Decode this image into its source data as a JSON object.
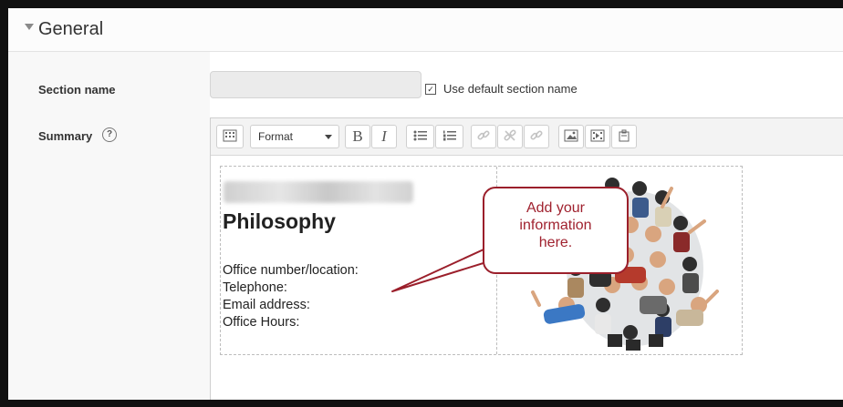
{
  "section": {
    "title": "General"
  },
  "form": {
    "section_name_label": "Section name",
    "section_name_value": "",
    "use_default_label": "Use default section name",
    "use_default_checked": true,
    "summary_label": "Summary",
    "help_glyph": "?"
  },
  "toolbar": {
    "format_label": "Format",
    "bold": "B",
    "italic": "I",
    "icons": [
      "toolbar-toggle-icon",
      "bold-icon",
      "italic-icon",
      "unordered-list-icon",
      "ordered-list-icon",
      "link-icon",
      "unlink-icon",
      "no-link-icon",
      "image-icon",
      "media-icon",
      "manage-files-icon"
    ]
  },
  "content": {
    "name_blurred": "Lorem, Dr. Donnie",
    "heading": "Philosophy",
    "lines": [
      "Office number/location:",
      "Telephone:",
      "Email address:",
      "Office Hours:"
    ]
  },
  "callout": {
    "lines": [
      "Add your",
      "information",
      "here."
    ]
  },
  "colors": {
    "callout": "#9b1f2b",
    "background": "#ffffff"
  }
}
